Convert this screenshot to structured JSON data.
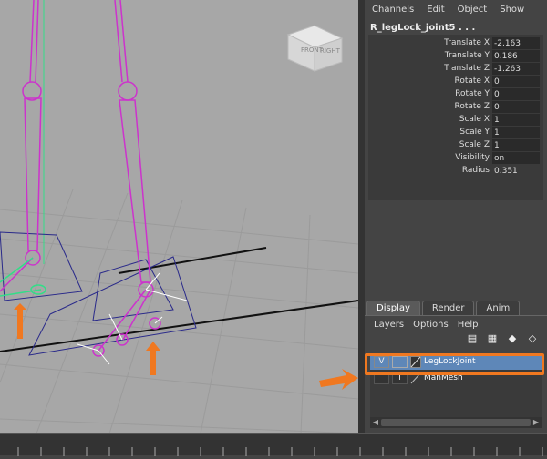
{
  "viewcube": {
    "front_label": "FRONT",
    "right_label": "RIGHT"
  },
  "channel_box": {
    "menu": [
      "Channels",
      "Edit",
      "Object",
      "Show"
    ],
    "node_name": "R_legLock_joint5 . . .",
    "attributes": [
      {
        "label": "Translate X",
        "value": "-2.163"
      },
      {
        "label": "Translate Y",
        "value": "0.186"
      },
      {
        "label": "Translate Z",
        "value": "-1.263"
      },
      {
        "label": "Rotate X",
        "value": "0"
      },
      {
        "label": "Rotate Y",
        "value": "0"
      },
      {
        "label": "Rotate Z",
        "value": "0"
      },
      {
        "label": "Scale X",
        "value": "1"
      },
      {
        "label": "Scale Y",
        "value": "1"
      },
      {
        "label": "Scale Z",
        "value": "1"
      },
      {
        "label": "Visibility",
        "value": "on"
      },
      {
        "label": "Radius",
        "value": "0.351"
      }
    ]
  },
  "layer_editor": {
    "tabs": [
      "Display",
      "Render",
      "Anim"
    ],
    "menu": [
      "Layers",
      "Options",
      "Help"
    ],
    "icons": [
      "new-layer-icon",
      "new-layer-selected-icon",
      "move-up-icon",
      "move-down-icon"
    ],
    "layers": [
      {
        "visibility": "V",
        "type": "",
        "name": "LegLockJoint",
        "selected": true
      },
      {
        "visibility": "",
        "type": "T",
        "name": "ManMesh",
        "selected": false
      }
    ]
  },
  "colors": {
    "highlight": "#f07820",
    "selection": "#5e87b8",
    "joint": "#cc33cc"
  }
}
